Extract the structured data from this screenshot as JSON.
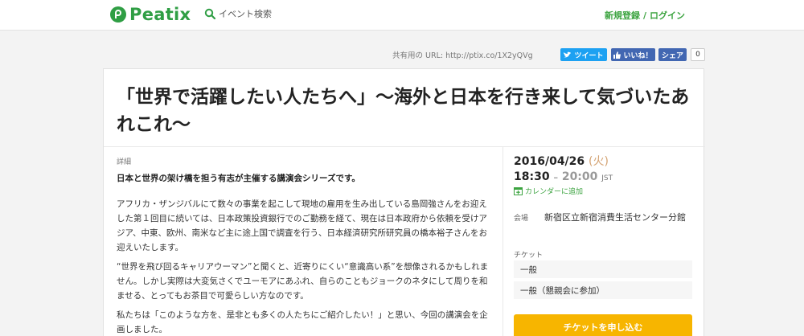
{
  "header": {
    "logo_text": "Peatix",
    "search_label": "イベント検索",
    "signup_label": "新規登録",
    "separator": "/",
    "login_label": "ログイン"
  },
  "share": {
    "url_text": "共有用の URL: http://ptix.co/1X2yQVg",
    "tweet_label": "ツイート",
    "like_label": "いいね！",
    "share_label": "シェア",
    "share_count": "0"
  },
  "event": {
    "title": "「世界で活躍したい人たちへ」〜海外と日本を行き来して気づいたあれこれ〜",
    "details_label": "詳細",
    "lead": "日本と世界の架け橋を担う有志が主催する講演会シリーズです。",
    "paragraphs": [
      "アフリカ・ザンジバルにて数々の事業を起こして現地の雇用を生み出している島岡強さんをお迎えした第１回目に続いては、日本政策投資銀行でのご勤務を経て、現在は日本政府から依頼を受けアジア、中東、欧州、南米など主に途上国で調査を行う、日本経済研究所研究員の橋本裕子さんをお迎えいたします。",
      "“世界を飛び回るキャリアウーマン”と聞くと、近寄りにくい“意識高い系”を想像されるかもしれません。しかし実際は大変気さくでユーモアにあふれ、自らのこともジョークのネタにして周りを和ませる、とってもお茶目で可愛らしい方なのです。",
      "私たちは「このような方を、是非とも多くの人たちにご紹介したい！」と思い、今回の講演会を企画しました。"
    ],
    "date": "2016/04/26",
    "day_of_week": "(火)",
    "start_time": "18:30",
    "time_dash": "–",
    "end_time": "20:00",
    "timezone": "JST",
    "calendar_label": "カレンダーに追加",
    "venue_label": "会場",
    "venue_value": "新宿区立新宿消費生活センター分館",
    "ticket_label": "チケット",
    "tickets": [
      "一般",
      "一般（懇親会に参加）"
    ],
    "buy_label": "チケットを申し込む"
  },
  "colors": {
    "brand_green": "#2f9e44",
    "link_green": "#3ba33f",
    "twitter_blue": "#1da1f2",
    "facebook_blue": "#4267b2",
    "cta_yellow": "#f7b500"
  }
}
